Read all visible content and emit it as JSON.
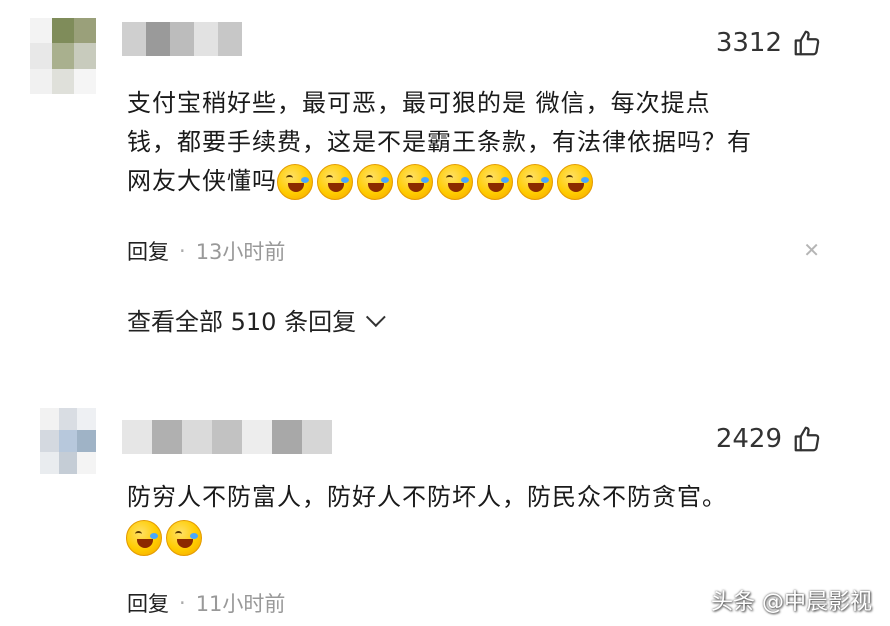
{
  "comments": [
    {
      "likes": "3312",
      "text_line1": "支付宝稍好些，最可恶，最可狠的是 微信，每次提点",
      "text_line2": "钱，都要手续费，这是不是霸王条款，有法律依据吗？有",
      "text_line3": "网友大侠懂吗",
      "emoji_count": 8,
      "emoji_name": "laugh-cry-emoji",
      "reply_label": "回复",
      "separator": "·",
      "time": "13小时前",
      "view_all_replies": "查看全部 510 条回复"
    },
    {
      "likes": "2429",
      "text_line1": "防穷人不防富人，防好人不防坏人，防民众不防贪官。",
      "emoji_count": 2,
      "emoji_name": "laugh-cry-emoji",
      "reply_label": "回复",
      "separator": "·",
      "time": "11小时前"
    }
  ],
  "icons": {
    "like": "thumbs-up-icon",
    "close": "close-icon",
    "expand": "chevron-down-icon"
  },
  "watermark": "头条 @中晨影视",
  "colors": {
    "time_gray": "#999999",
    "text": "#1a1a1a",
    "emoji_yellow": "#ffcc00"
  }
}
